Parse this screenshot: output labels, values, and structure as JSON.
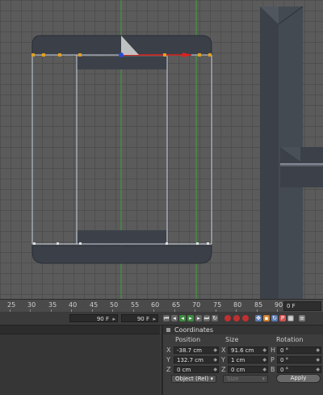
{
  "ruler": {
    "ticks": [
      "25",
      "30",
      "35",
      "40",
      "45",
      "50",
      "55",
      "60",
      "65",
      "70",
      "75",
      "80",
      "85",
      "90"
    ],
    "current_frame": "0 F"
  },
  "transport": {
    "end_frame_1": "90 F",
    "end_frame_2": "90 F",
    "buttons": [
      "jump-start",
      "prev-key",
      "play-back",
      "play-forward",
      "next-key",
      "jump-end",
      "record",
      "autokey",
      "keyframe-selection",
      "position-key",
      "rotation-key",
      "scale-key",
      "param-key",
      "pla-key",
      "timeline-settings"
    ]
  },
  "coordinates": {
    "title": "Coordinates",
    "columns": {
      "position": "Position",
      "size": "Size",
      "rotation": "Rotation"
    },
    "rows": [
      {
        "pos_label": "X",
        "pos_value": "-38.7 cm",
        "size_label": "X",
        "size_value": "91.6 cm",
        "rot_label": "H",
        "rot_value": "0 °"
      },
      {
        "pos_label": "Y",
        "pos_value": "132.7 cm",
        "size_label": "Y",
        "size_value": "1 cm",
        "rot_label": "P",
        "rot_value": "0 °"
      },
      {
        "pos_label": "Z",
        "pos_value": "0 cm",
        "size_label": "Z",
        "size_value": "0 cm",
        "rot_label": "B",
        "rot_value": "0 °"
      }
    ],
    "mode": "Object (Rel)",
    "size_mode": "Size",
    "apply_label": "Apply"
  }
}
